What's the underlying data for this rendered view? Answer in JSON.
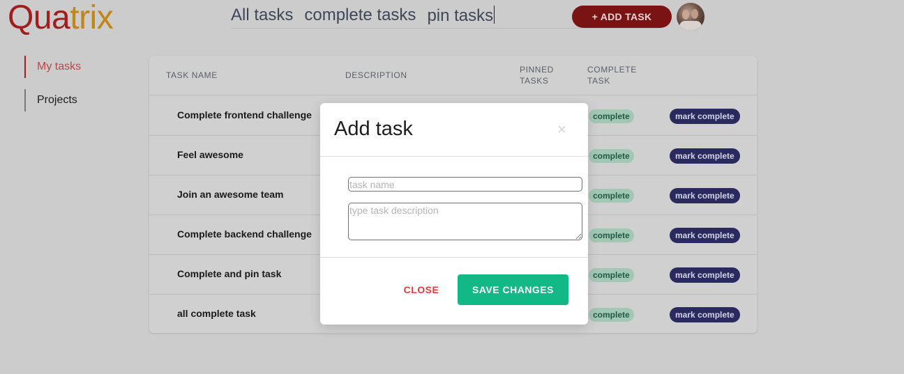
{
  "app": {
    "logo_part1": "Qua",
    "logo_part2": "trix"
  },
  "topnav": {
    "items": [
      "All tasks",
      "complete tasks",
      "pin tasks"
    ]
  },
  "header": {
    "add_task_label": "+ ADD TASK",
    "avatar_icon": "user-avatar"
  },
  "sidebar": {
    "items": [
      {
        "label": "My tasks",
        "active": true
      },
      {
        "label": "Projects",
        "active": false
      }
    ]
  },
  "table": {
    "headers": {
      "task_name": "TASK NAME",
      "description": "DESCRIPTION",
      "pinned_1": "PINNED",
      "pinned_2": "TASKS",
      "complete_1": "COMPLETE",
      "complete_2": "TASK"
    },
    "rows": [
      {
        "name": "Complete frontend challenge",
        "status": "complete",
        "action": "mark complete"
      },
      {
        "name": "Feel awesome",
        "status": "complete",
        "action": "mark complete"
      },
      {
        "name": "Join an awesome team",
        "status": "complete",
        "action": "mark complete"
      },
      {
        "name": "Complete backend challenge",
        "status": "complete",
        "action": "mark complete"
      },
      {
        "name": "Complete and pin task",
        "status": "complete",
        "action": "mark complete"
      },
      {
        "name": "all complete task",
        "status": "complete",
        "action": "mark complete"
      }
    ]
  },
  "modal": {
    "title": "Add task",
    "close_icon": "×",
    "task_name_placeholder": "task name",
    "task_name_value": "",
    "description_placeholder": "type task description",
    "description_value": "",
    "close_label": "CLOSE",
    "save_label": "SAVE CHANGES"
  },
  "colors": {
    "brand_red": "#a11e1e",
    "brand_orange": "#c0861a",
    "save_green": "#12b886",
    "close_red": "#de3b3b",
    "mark_complete_navy": "#2a2a5e"
  }
}
